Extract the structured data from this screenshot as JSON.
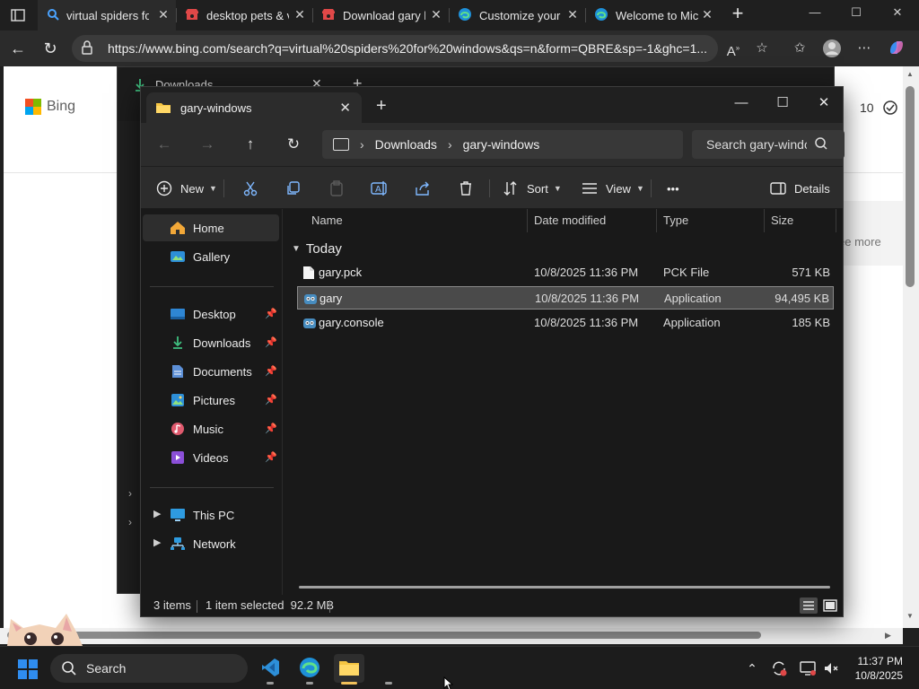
{
  "browser": {
    "tabs": [
      {
        "title": "virtual spiders for windows - Search",
        "close": "✕",
        "active": true,
        "color": "#3b6fe0"
      },
      {
        "title": "desktop pets & virtual friends",
        "close": "✕",
        "active": false,
        "color": "#e04848"
      },
      {
        "title": "Download gary by",
        "close": "✕",
        "active": false,
        "color": "#e04848"
      },
      {
        "title": "Customize your b",
        "close": "✕",
        "active": false,
        "color": "#33a7d8"
      },
      {
        "title": "Welcome to Micr",
        "close": "✕",
        "active": false,
        "color": "#33a7d8"
      }
    ],
    "new_tab": "+",
    "url": "https://www.bing.com/search?q=virtual%20spiders%20for%20windows&qs=n&form=QBRE&sp=-1&ghc=1...",
    "window_controls": {
      "minimize": "—",
      "maximize": "☐",
      "close": "✕"
    }
  },
  "webpage": {
    "brand": "Bing",
    "result_count": "10",
    "see_more": "ee more"
  },
  "background_window": {
    "tab_title": "Downloads",
    "close": "✕",
    "new_tab": "+"
  },
  "explorer": {
    "tab_title": "gary-windows",
    "tab_close": "✕",
    "new_tab": "+",
    "controls": {
      "minimize": "—",
      "maximize": "☐",
      "close": "✕"
    },
    "breadcrumb": [
      "Downloads",
      "gary-windows"
    ],
    "breadcrumb_sep": "›",
    "search_placeholder": "Search gary-windows",
    "toolbar": {
      "new_label": "New",
      "sort_label": "Sort",
      "view_label": "View",
      "more_label": "•••",
      "details_label": "Details"
    },
    "nav": {
      "home": "Home",
      "gallery": "Gallery",
      "desktop": "Desktop",
      "downloads": "Downloads",
      "documents": "Documents",
      "pictures": "Pictures",
      "music": "Music",
      "videos": "Videos",
      "this_pc": "This PC",
      "network": "Network"
    },
    "columns": {
      "name": "Name",
      "date": "Date modified",
      "type": "Type",
      "size": "Size"
    },
    "group_label": "Today",
    "files": [
      {
        "name": "gary.pck",
        "date": "10/8/2025 11:36 PM",
        "type": "PCK File",
        "size": "571 KB",
        "icon": "file-icon"
      },
      {
        "name": "gary",
        "date": "10/8/2025 11:36 PM",
        "type": "Application",
        "size": "94,495 KB",
        "icon": "godot-app-icon"
      },
      {
        "name": "gary.console",
        "date": "10/8/2025 11:36 PM",
        "type": "Application",
        "size": "185 KB",
        "icon": "godot-app-icon"
      }
    ],
    "status": {
      "count": "3 items",
      "selection": "1 item selected  92.2 MB"
    }
  },
  "taskbar": {
    "search_label": "Search",
    "time": "11:37 PM",
    "date": "10/8/2025"
  }
}
